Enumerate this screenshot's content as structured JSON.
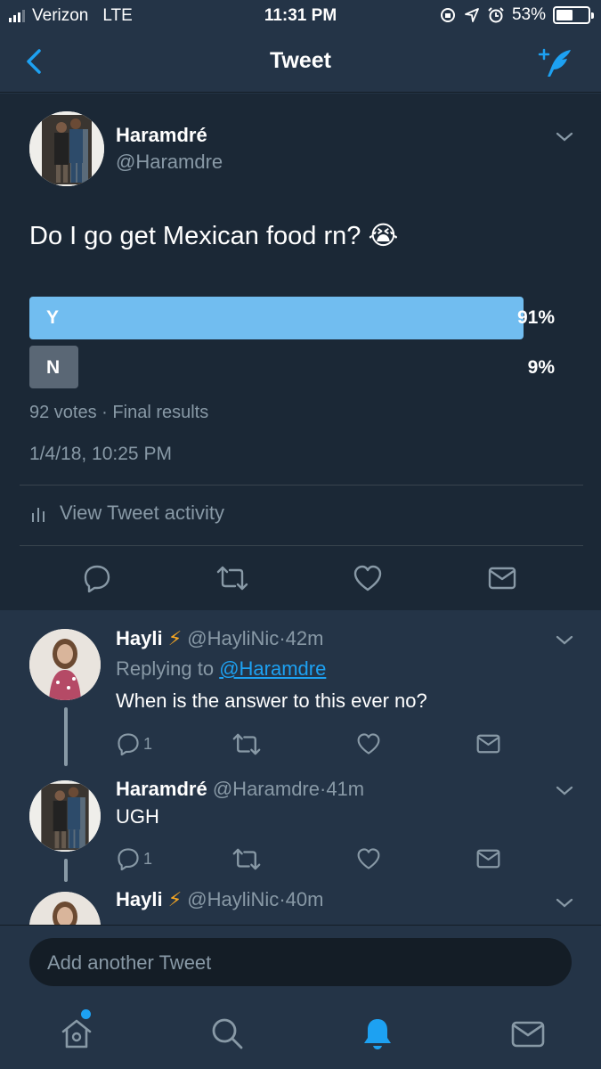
{
  "status_bar": {
    "carrier": "Verizon",
    "network": "LTE",
    "time": "11:31 PM",
    "battery": "53%",
    "battery_level": 0.53
  },
  "nav": {
    "title": "Tweet"
  },
  "tweet": {
    "author_name": "Haramdré",
    "author_handle": "@Haramdre",
    "text": "Do I go get Mexican food rn? 😭",
    "poll": {
      "options": [
        {
          "label": "Y",
          "percent": "91%",
          "fraction": 0.91,
          "color": "#71bdf0"
        },
        {
          "label": "N",
          "percent": "9%",
          "fraction": 0.09,
          "color": "#5a6775"
        }
      ],
      "votes": "92 votes",
      "status": "Final results",
      "separator": "·"
    },
    "timestamp": "1/4/18, 10:25 PM",
    "activity_label": "View Tweet activity"
  },
  "replies": [
    {
      "name": "Hayli",
      "emoji": "⚡",
      "handle": "@HayliNic",
      "separator": "·",
      "time": "42m",
      "replying_prefix": "Replying to",
      "replying_to": "@Haramdre",
      "text": "When is the answer to this ever no?",
      "reply_count": "1"
    },
    {
      "name": "Haramdré",
      "handle": "@Haramdre",
      "separator": "·",
      "time": "41m",
      "text": "UGH",
      "reply_count": "1"
    },
    {
      "name": "Hayli",
      "emoji": "⚡",
      "handle": "@HayliNic",
      "separator": "·",
      "time": "40m"
    }
  ],
  "composer": {
    "placeholder": "Add another Tweet"
  },
  "colors": {
    "accent": "#1da1f2",
    "background": "#243447",
    "card": "#1b2836",
    "muted": "#8899a6"
  },
  "icons": [
    "back-icon",
    "compose-icon",
    "chevron-down-icon",
    "reply-icon",
    "retweet-icon",
    "like-icon",
    "dm-icon",
    "home-icon",
    "search-icon",
    "notifications-icon",
    "messages-icon",
    "analytics-icon"
  ]
}
